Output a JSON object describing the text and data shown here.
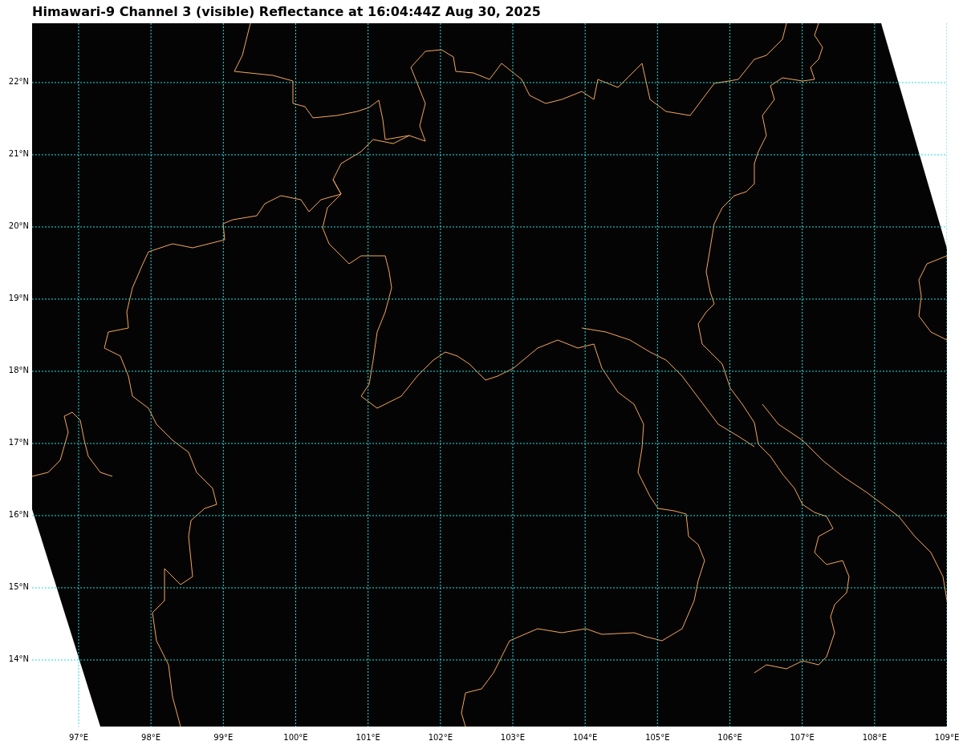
{
  "title": "Himawari-9 Channel 3 (visible) Reflectance at 16:04:44Z Aug 30, 2025",
  "map": {
    "latitude_labels": [
      "22°N",
      "21°N",
      "20°N",
      "19°N",
      "18°N",
      "17°N",
      "16°N",
      "15°N",
      "14°N"
    ],
    "longitude_labels": [
      "97°E",
      "98°E",
      "99°E",
      "100°E",
      "101°E",
      "102°E",
      "103°E",
      "104°E",
      "105°E",
      "106°E",
      "107°E",
      "108°E",
      "109°E"
    ]
  }
}
